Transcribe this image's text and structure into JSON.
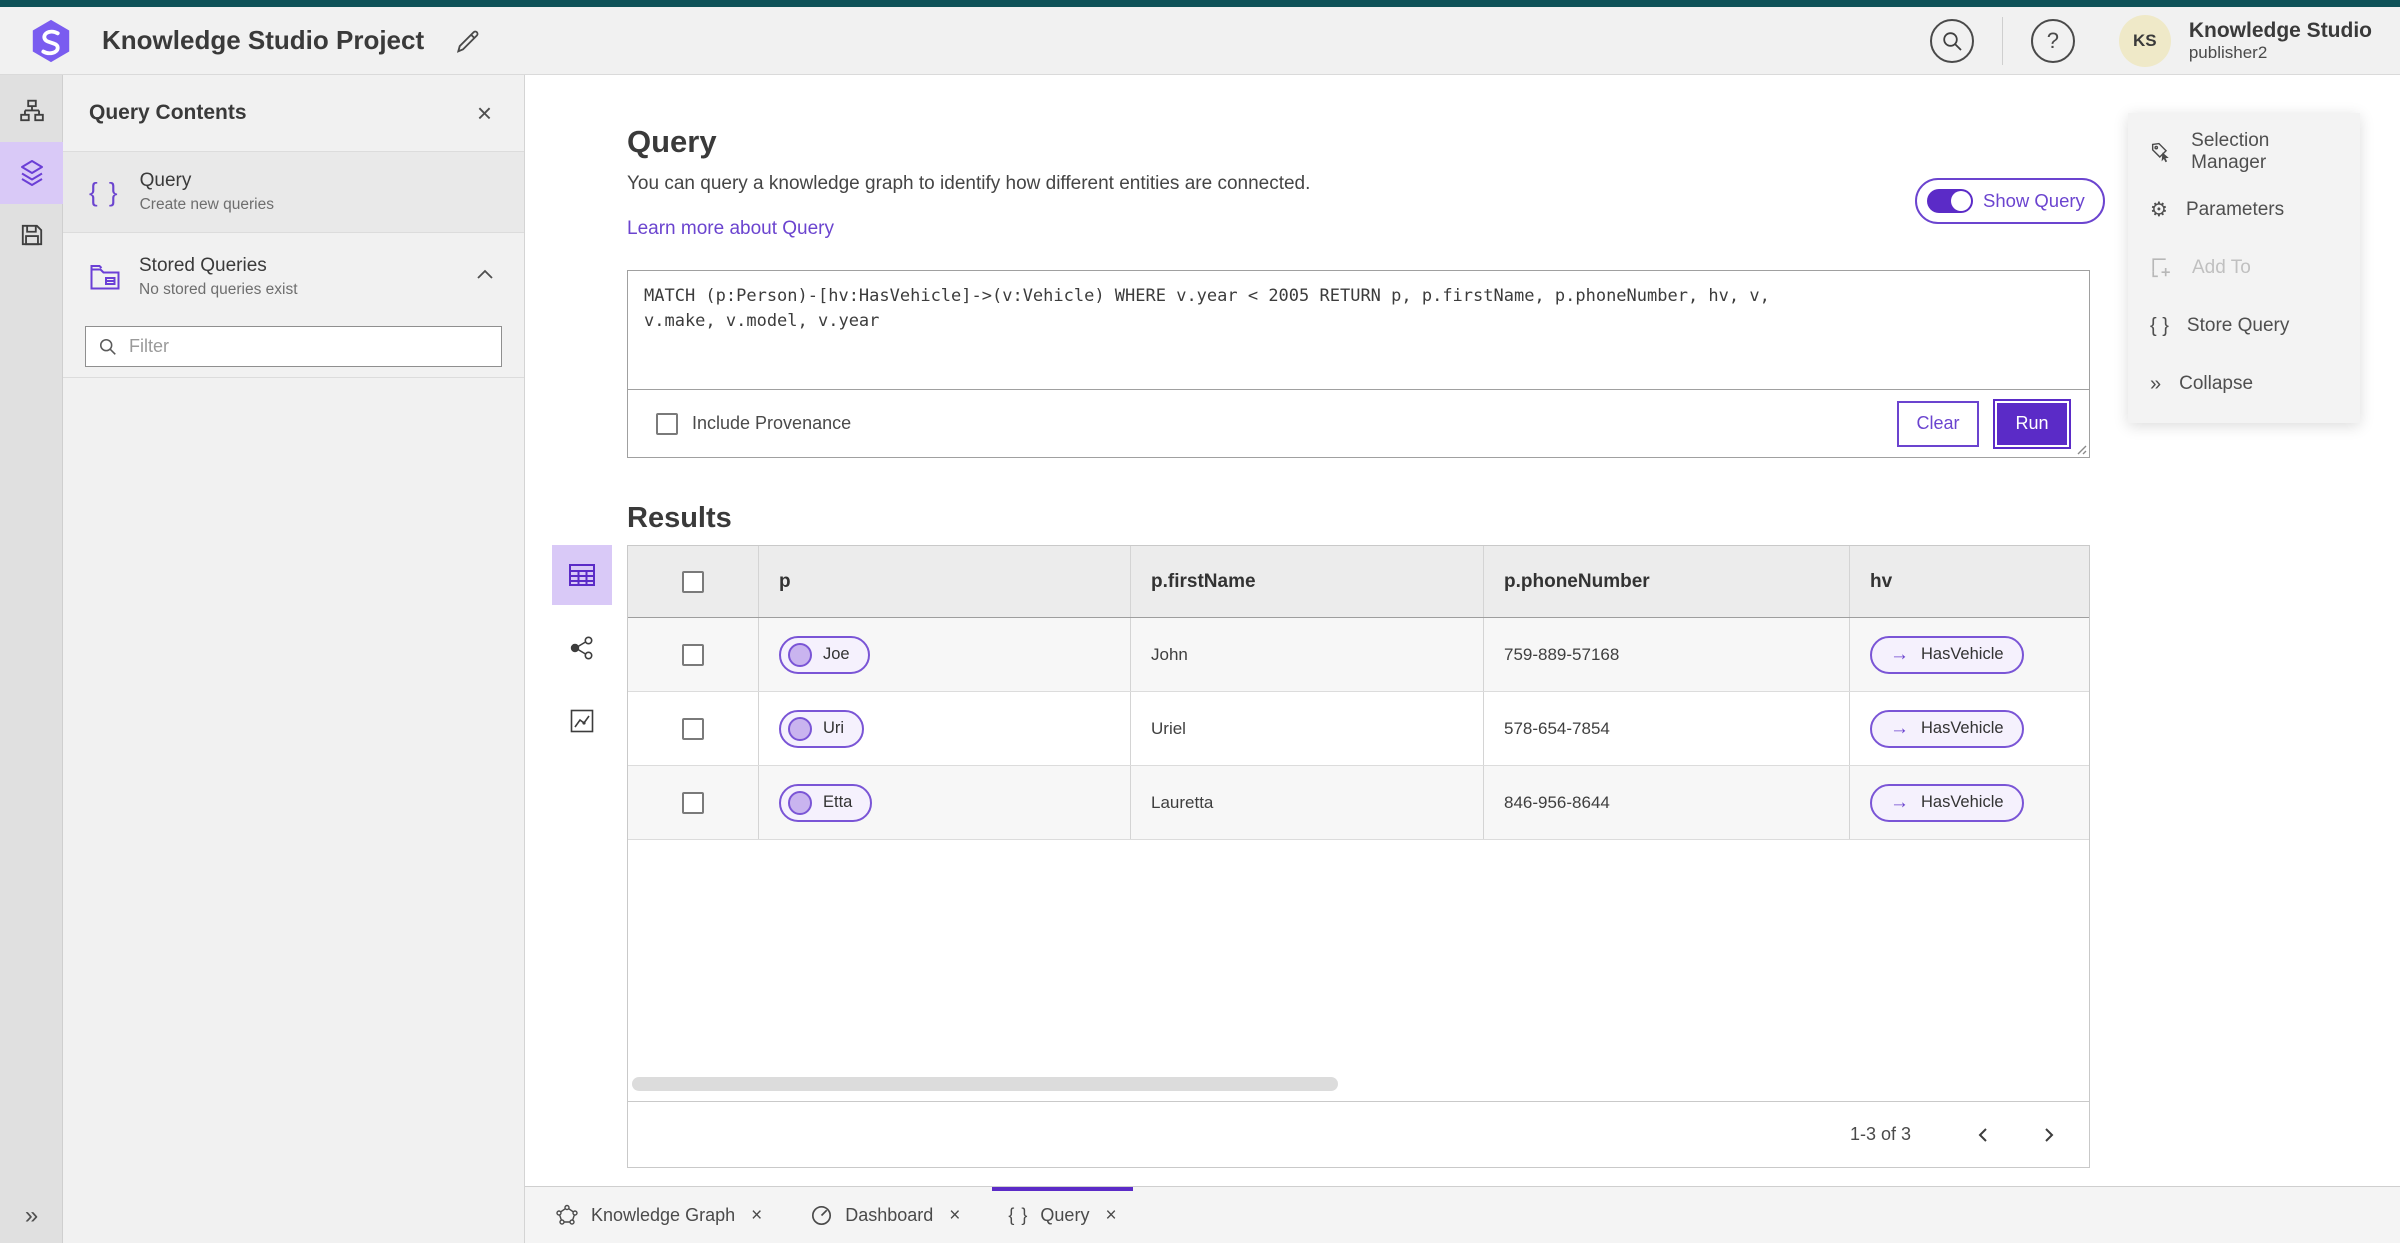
{
  "colors": {
    "accent": "#6b44cf",
    "accent-dark": "#5b2bc7",
    "accent-bg": "#d9c9f7",
    "pill-bg": "#f5f1fd",
    "pill-circle": "#c9b4ef",
    "teal": "#0f5258",
    "avatar-bg": "#efe9c8"
  },
  "icons": {
    "braces": "{ }",
    "collapse": "»",
    "gear": "⚙",
    "close": "×",
    "help": "?",
    "arrow_right": "→",
    "expand": "»"
  },
  "topbar": {
    "title": "Knowledge Studio Project",
    "user": {
      "initials": "KS",
      "name": "Knowledge Studio",
      "role": "publisher2"
    }
  },
  "contents_panel": {
    "title": "Query Contents",
    "query_item": {
      "label": "Query",
      "description": "Create new queries"
    },
    "stored_queries": {
      "label": "Stored Queries",
      "description": "No stored queries exist"
    },
    "filter_placeholder": "Filter"
  },
  "query_section": {
    "heading": "Query",
    "description": "You can query a knowledge graph to identify how different entities are connected.",
    "learn_more": "Learn more about Query",
    "show_query": "Show Query",
    "query_text": "MATCH (p:Person)-[hv:HasVehicle]->(v:Vehicle) WHERE v.year < 2005 RETURN p, p.firstName, p.phoneNumber, hv, v,\nv.make, v.model, v.year",
    "include_provenance": "Include Provenance",
    "clear": "Clear",
    "run": "Run"
  },
  "results": {
    "heading": "Results",
    "columns": [
      "p",
      "p.firstName",
      "p.phoneNumber",
      "hv"
    ],
    "rows": [
      {
        "p": "Joe",
        "firstName": "John",
        "phone": "759-889-57168",
        "hv": "HasVehicle"
      },
      {
        "p": "Uri",
        "firstName": "Uriel",
        "phone": "578-654-7854",
        "hv": "HasVehicle"
      },
      {
        "p": "Etta",
        "firstName": "Lauretta",
        "phone": "846-956-8644",
        "hv": "HasVehicle"
      }
    ],
    "pagination": "1-3 of 3"
  },
  "side_panel": {
    "items": [
      {
        "label": "Selection Manager"
      },
      {
        "label": "Parameters"
      },
      {
        "label": "Add To"
      },
      {
        "label": "Store Query"
      },
      {
        "label": "Collapse"
      }
    ]
  },
  "tabs": [
    {
      "label": "Knowledge Graph"
    },
    {
      "label": "Dashboard"
    },
    {
      "label": "Query"
    }
  ]
}
